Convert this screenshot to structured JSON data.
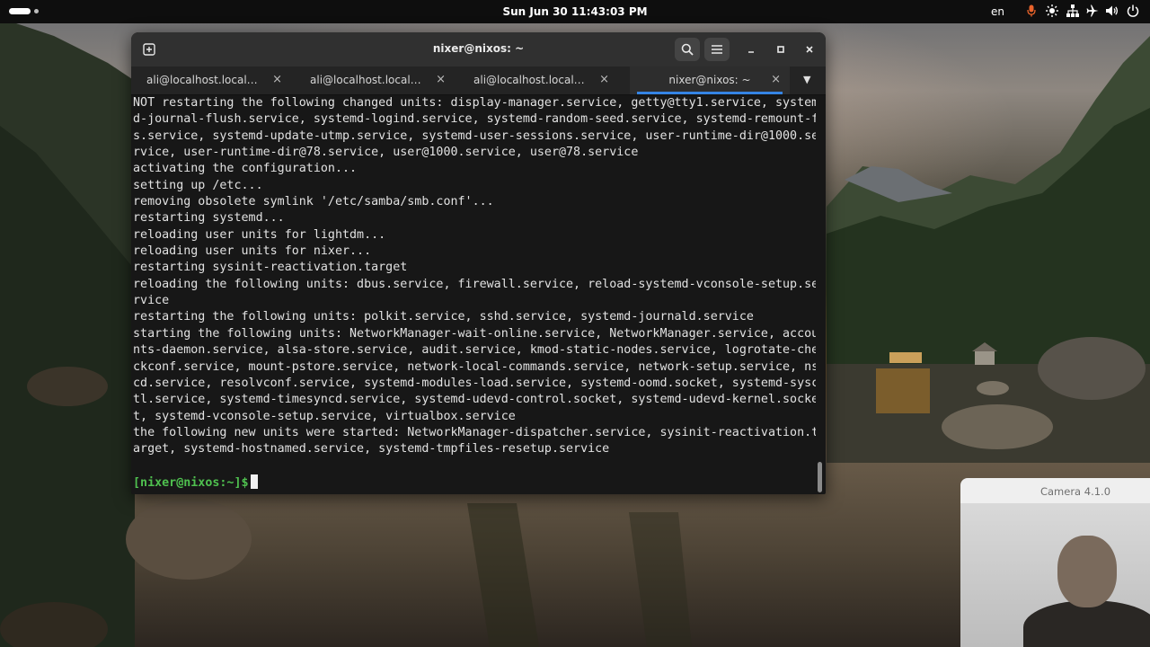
{
  "topbar": {
    "clock": "Sun Jun 30  11:43:03 PM",
    "language": "en",
    "tray_icons": [
      "microphone-icon",
      "brightness-icon",
      "network-icon",
      "airplane-mode-icon",
      "volume-icon",
      "power-icon"
    ]
  },
  "terminal": {
    "title": "nixer@nixos: ~",
    "tabs": [
      {
        "label": "ali@localhost.localdo…",
        "active": false
      },
      {
        "label": "ali@localhost.localdo…",
        "active": false
      },
      {
        "label": "ali@localhost.localdom…",
        "active": false
      },
      {
        "label": "nixer@nixos: ~",
        "active": true
      }
    ],
    "lines": [
      "NOT restarting the following changed units: display-manager.service, getty@tty1.service, system",
      "d-journal-flush.service, systemd-logind.service, systemd-random-seed.service, systemd-remount-f",
      "s.service, systemd-update-utmp.service, systemd-user-sessions.service, user-runtime-dir@1000.se",
      "rvice, user-runtime-dir@78.service, user@1000.service, user@78.service",
      "activating the configuration...",
      "setting up /etc...",
      "removing obsolete symlink '/etc/samba/smb.conf'...",
      "restarting systemd...",
      "reloading user units for lightdm...",
      "reloading user units for nixer...",
      "restarting sysinit-reactivation.target",
      "reloading the following units: dbus.service, firewall.service, reload-systemd-vconsole-setup.se",
      "rvice",
      "restarting the following units: polkit.service, sshd.service, systemd-journald.service",
      "starting the following units: NetworkManager-wait-online.service, NetworkManager.service, accou",
      "nts-daemon.service, alsa-store.service, audit.service, kmod-static-nodes.service, logrotate-che",
      "ckconf.service, mount-pstore.service, network-local-commands.service, network-setup.service, ns",
      "cd.service, resolvconf.service, systemd-modules-load.service, systemd-oomd.socket, systemd-sysc",
      "tl.service, systemd-timesyncd.service, systemd-udevd-control.socket, systemd-udevd-kernel.socke",
      "t, systemd-vconsole-setup.service, virtualbox.service",
      "the following new units were started: NetworkManager-dispatcher.service, sysinit-reactivation.t",
      "arget, systemd-hostnamed.service, systemd-tmpfiles-resetup.service",
      ""
    ],
    "prompt": "[nixer@nixos:~]$"
  },
  "camera": {
    "title": "Camera 4.1.0"
  }
}
